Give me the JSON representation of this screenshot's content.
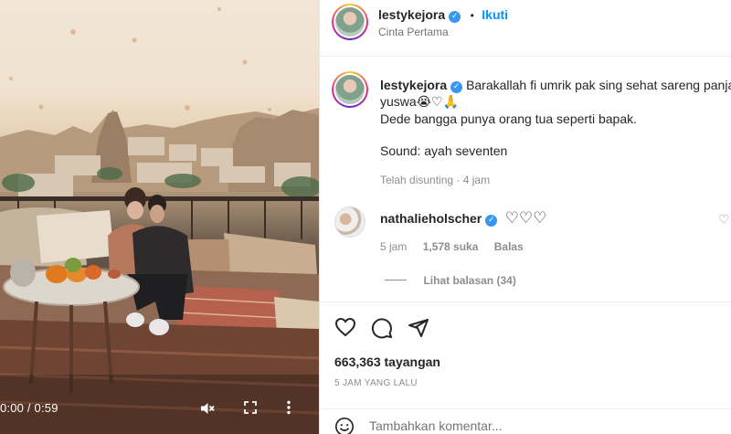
{
  "video": {
    "timecode": "0:00 / 0:59"
  },
  "header": {
    "username": "lestykejora",
    "separator": "•",
    "follow_label": "Ikuti",
    "audio_label": "Cinta Pertama"
  },
  "caption": {
    "username": "lestykejora",
    "line1": "Barakallah fi umrik pak sing sehat sareng panjang",
    "line2": "yuswa😭♡🙏",
    "line3": "Dede bangga punya orang tua seperti bapak.",
    "line4": "Sound: ayah seventen",
    "edited": "Telah disunting · 4 jam"
  },
  "comment": {
    "username": "nathalieholscher",
    "text": "♡♡♡",
    "time": "5 jam",
    "likes": "1,578 suka",
    "reply_label": "Balas",
    "view_replies": "Lihat balasan (34)"
  },
  "stats": {
    "views": "663,363 tayangan",
    "posted": "5 JAM YANG LALU"
  },
  "add_comment": {
    "placeholder": "Tambahkan komentar..."
  },
  "colors": {
    "accent": "#0095f6",
    "verified": "#3897f0",
    "text": "#262626",
    "muted": "#8e8e8e"
  }
}
